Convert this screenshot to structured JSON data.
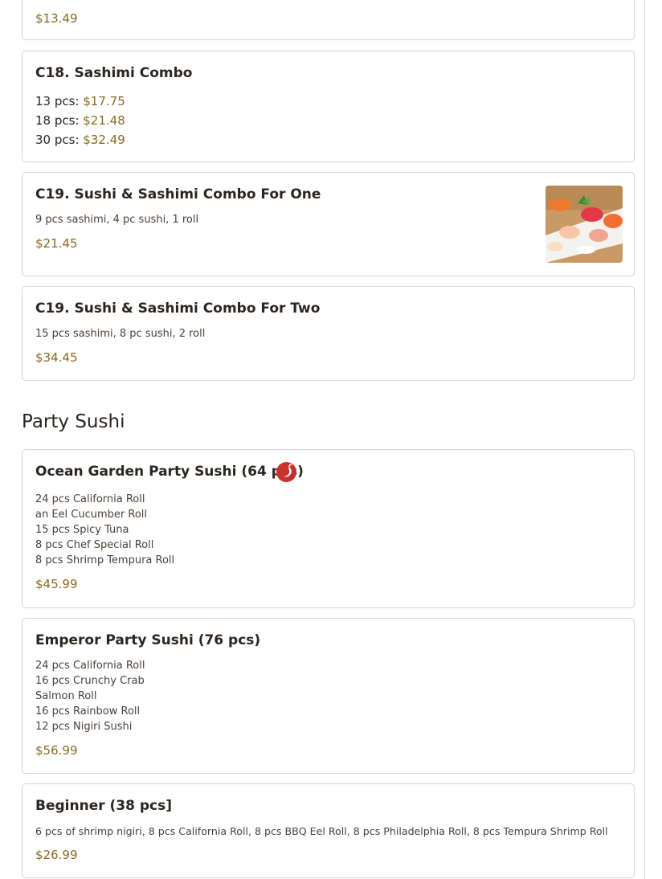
{
  "colors": {
    "price": "#8a6a1c",
    "border": "#d9d5d1",
    "text": "#2b2520",
    "spicy": "#c8312c"
  },
  "top_card": {
    "price": "$13.49"
  },
  "c18": {
    "title": "C18. Sashimi Combo",
    "options": [
      {
        "label": "13 pcs: ",
        "price": "$17.75"
      },
      {
        "label": "18 pcs: ",
        "price": "$21.48"
      },
      {
        "label": "30 pcs: ",
        "price": "$32.49"
      }
    ]
  },
  "c19_one": {
    "title": "C19. Sushi & Sashimi Combo For One",
    "desc": "9 pcs sashimi, 4 pc sushi, 1 roll",
    "price": "$21.45",
    "image": "sushi-sashimi-platter-photo"
  },
  "c19_two": {
    "title": "C19. Sushi & Sashimi Combo For Two",
    "desc": "15 pcs sashimi, 8 pc sushi, 2 roll",
    "price": "$34.45"
  },
  "section": {
    "title": "Party Sushi"
  },
  "ocean": {
    "title": "Ocean Garden Party Sushi (64 pcs)",
    "icon": "spicy-icon",
    "lines": [
      "24 pcs California Roll",
      "an Eel Cucumber Roll",
      "15 pcs Spicy Tuna",
      "8 pcs Chef Special Roll",
      "8 pcs Shrimp Tempura Roll"
    ],
    "price": "$45.99"
  },
  "emperor": {
    "title": "Emperor Party Sushi (76 pcs)",
    "lines": [
      "24 pcs California Roll",
      "16 pcs Crunchy Crab",
      "Salmon Roll",
      "16 pcs Rainbow Roll",
      "12 pcs Nigiri Sushi"
    ],
    "price": "$56.99"
  },
  "beginner": {
    "title": "Beginner (38 pcs]",
    "desc": "6 pcs of shrimp nigiri, 8 pcs California Roll, 8 pcs BBQ Eel Roll, 8 pcs Philadelphia Roll, 8 pcs Tempura Shrimp Roll",
    "price": "$26.99"
  }
}
